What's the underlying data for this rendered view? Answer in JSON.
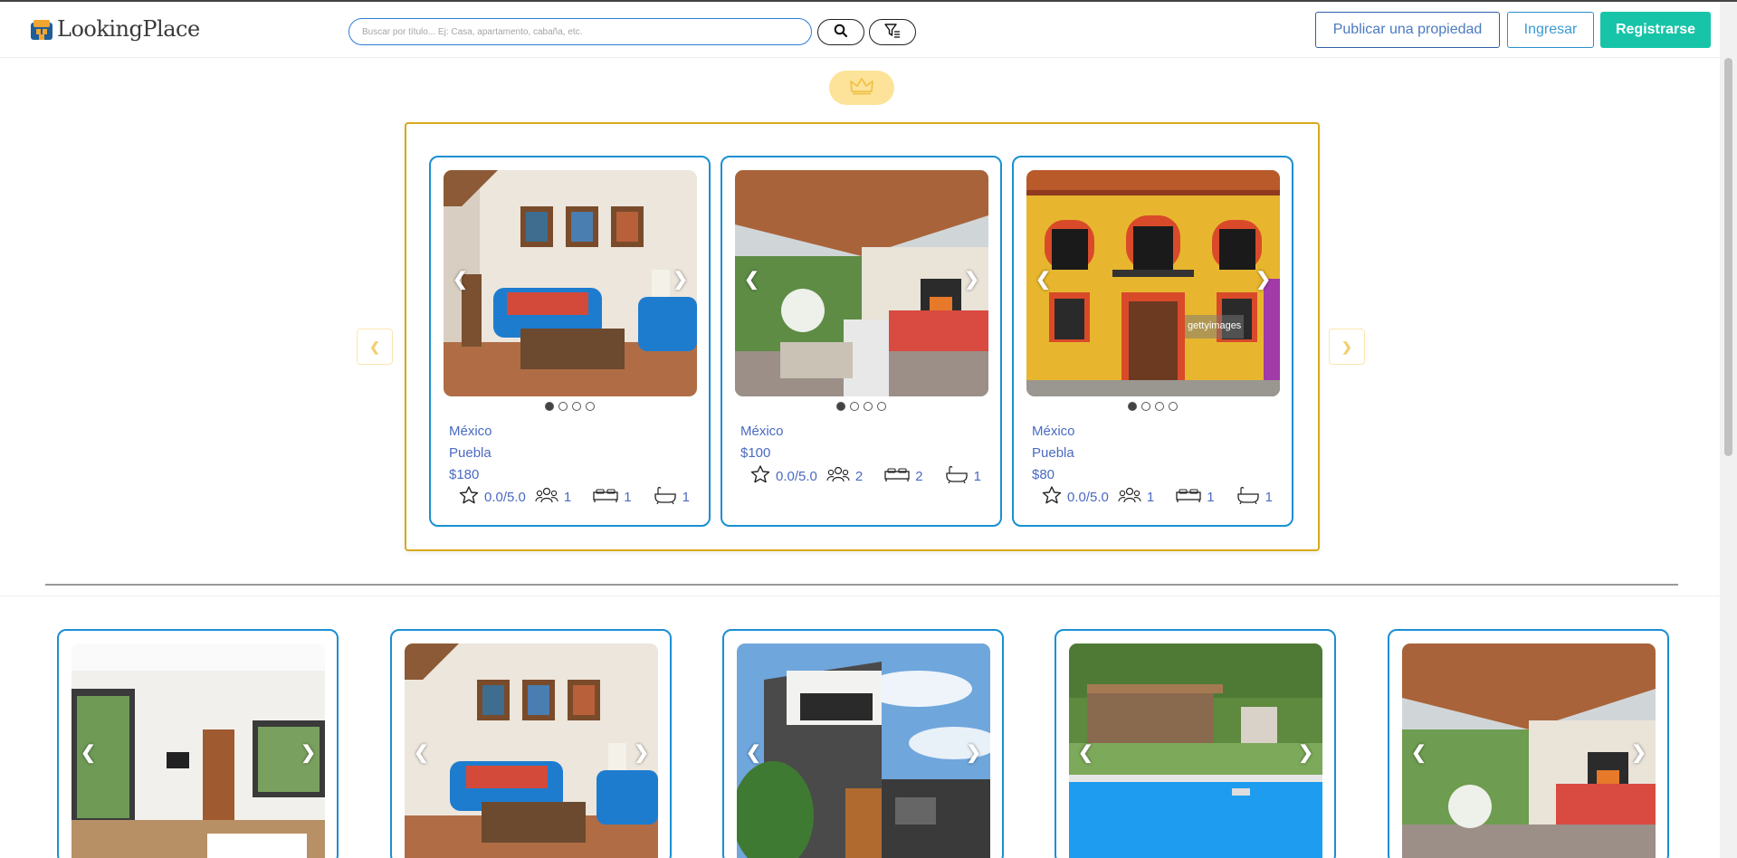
{
  "header": {
    "logo_text": "LookingPlace",
    "search_placeholder": "Buscar por título... Ej: Casa, apartamento, cabaña, etc.",
    "publish_label": "Publicar una propiedad",
    "login_label": "Ingresar",
    "register_label": "Registrarse"
  },
  "premium": {
    "prev_label": "❮",
    "next_label": "❯",
    "cards": [
      {
        "country": "México",
        "city": "Puebla",
        "price": "$180",
        "rating": "0.0/5.0",
        "guests": "1",
        "beds": "1",
        "baths": "1"
      },
      {
        "country": "México",
        "price": "$100",
        "rating": "0.0/5.0",
        "guests": "2",
        "beds": "2",
        "baths": "1"
      },
      {
        "country": "México",
        "city": "Puebla",
        "price": "$80",
        "rating": "0.0/5.0",
        "guests": "1",
        "beds": "1",
        "baths": "1"
      }
    ]
  },
  "image_nav": {
    "prev": "❮",
    "next": "❯"
  },
  "colors": {
    "accent_blue": "#1a8fd4",
    "gold": "#d9a91c",
    "register_green": "#18c4a8",
    "text_blue": "#4a6ac2"
  }
}
